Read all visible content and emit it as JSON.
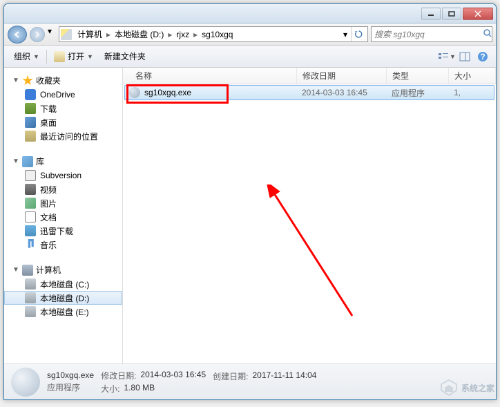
{
  "breadcrumb": {
    "items": [
      "计算机",
      "本地磁盘 (D:)",
      "rjxz",
      "sg10xgq"
    ]
  },
  "search": {
    "placeholder": "搜索 sg10xgq"
  },
  "toolbar": {
    "organize": "组织",
    "open": "打开",
    "newfolder": "新建文件夹"
  },
  "sidebar": {
    "favorites": {
      "label": "收藏夹",
      "items": [
        {
          "label": "OneDrive"
        },
        {
          "label": "下载"
        },
        {
          "label": "桌面"
        },
        {
          "label": "最近访问的位置"
        }
      ]
    },
    "libraries": {
      "label": "库",
      "items": [
        {
          "label": "Subversion"
        },
        {
          "label": "视频"
        },
        {
          "label": "图片"
        },
        {
          "label": "文档"
        },
        {
          "label": "迅雷下载"
        },
        {
          "label": "音乐"
        }
      ]
    },
    "computer": {
      "label": "计算机",
      "items": [
        {
          "label": "本地磁盘 (C:)"
        },
        {
          "label": "本地磁盘 (D:)"
        },
        {
          "label": "本地磁盘 (E:)"
        }
      ]
    }
  },
  "columns": {
    "name": "名称",
    "date": "修改日期",
    "type": "类型",
    "size": "大小"
  },
  "files": [
    {
      "name": "sg10xgq.exe",
      "date": "2014-03-03 16:45",
      "type": "应用程序",
      "size": "1,"
    }
  ],
  "status": {
    "filename": "sg10xgq.exe",
    "filetype": "应用程序",
    "modlabel": "修改日期:",
    "moddate": "2014-03-03 16:45",
    "sizelabel": "大小:",
    "size": "1.80 MB",
    "createlabel": "创建日期:",
    "createdate": "2017-11-11 14:04"
  },
  "watermark": "系统之家"
}
